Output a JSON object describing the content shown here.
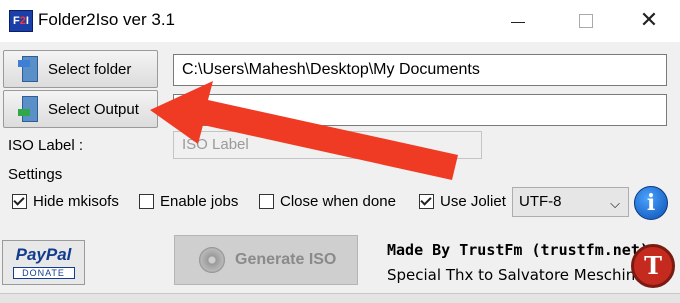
{
  "window": {
    "app_icon_text_left": "F",
    "app_icon_text_mid": "2",
    "app_icon_text_right": "I",
    "title": "Folder2Iso ver 3.1",
    "minimize_icon": "minimize-icon",
    "maximize_icon": "maximize-icon",
    "close_glyph": "✕"
  },
  "folder": {
    "select_label": "Select folder",
    "path": "C:\\Users\\Mahesh\\Desktop\\My Documents"
  },
  "output": {
    "select_label": "Select Output",
    "path": ""
  },
  "iso": {
    "label": "ISO Label :",
    "placeholder": "ISO Label"
  },
  "settings": {
    "heading": "Settings",
    "hide_mkisofs": {
      "label": "Hide mkisofs",
      "checked": true
    },
    "enable_jobs": {
      "label": "Enable jobs",
      "checked": false
    },
    "close_when_done": {
      "label": "Close when done",
      "checked": false
    },
    "use_joliet": {
      "label": "Use Joliet",
      "checked": true
    },
    "encoding": "UTF-8",
    "encoding_chevron": "⌵",
    "info_glyph": "i"
  },
  "footer": {
    "paypal_text": "PayPal",
    "donate_text": "DONATE",
    "generate_label": "Generate ISO",
    "made_by": "Made By TrustFm (trustfm.net)",
    "thanks": "Special Thx to Salvatore Meschini",
    "logo_glyph": "T"
  },
  "colors": {
    "annotation_arrow": "#f03b24"
  }
}
